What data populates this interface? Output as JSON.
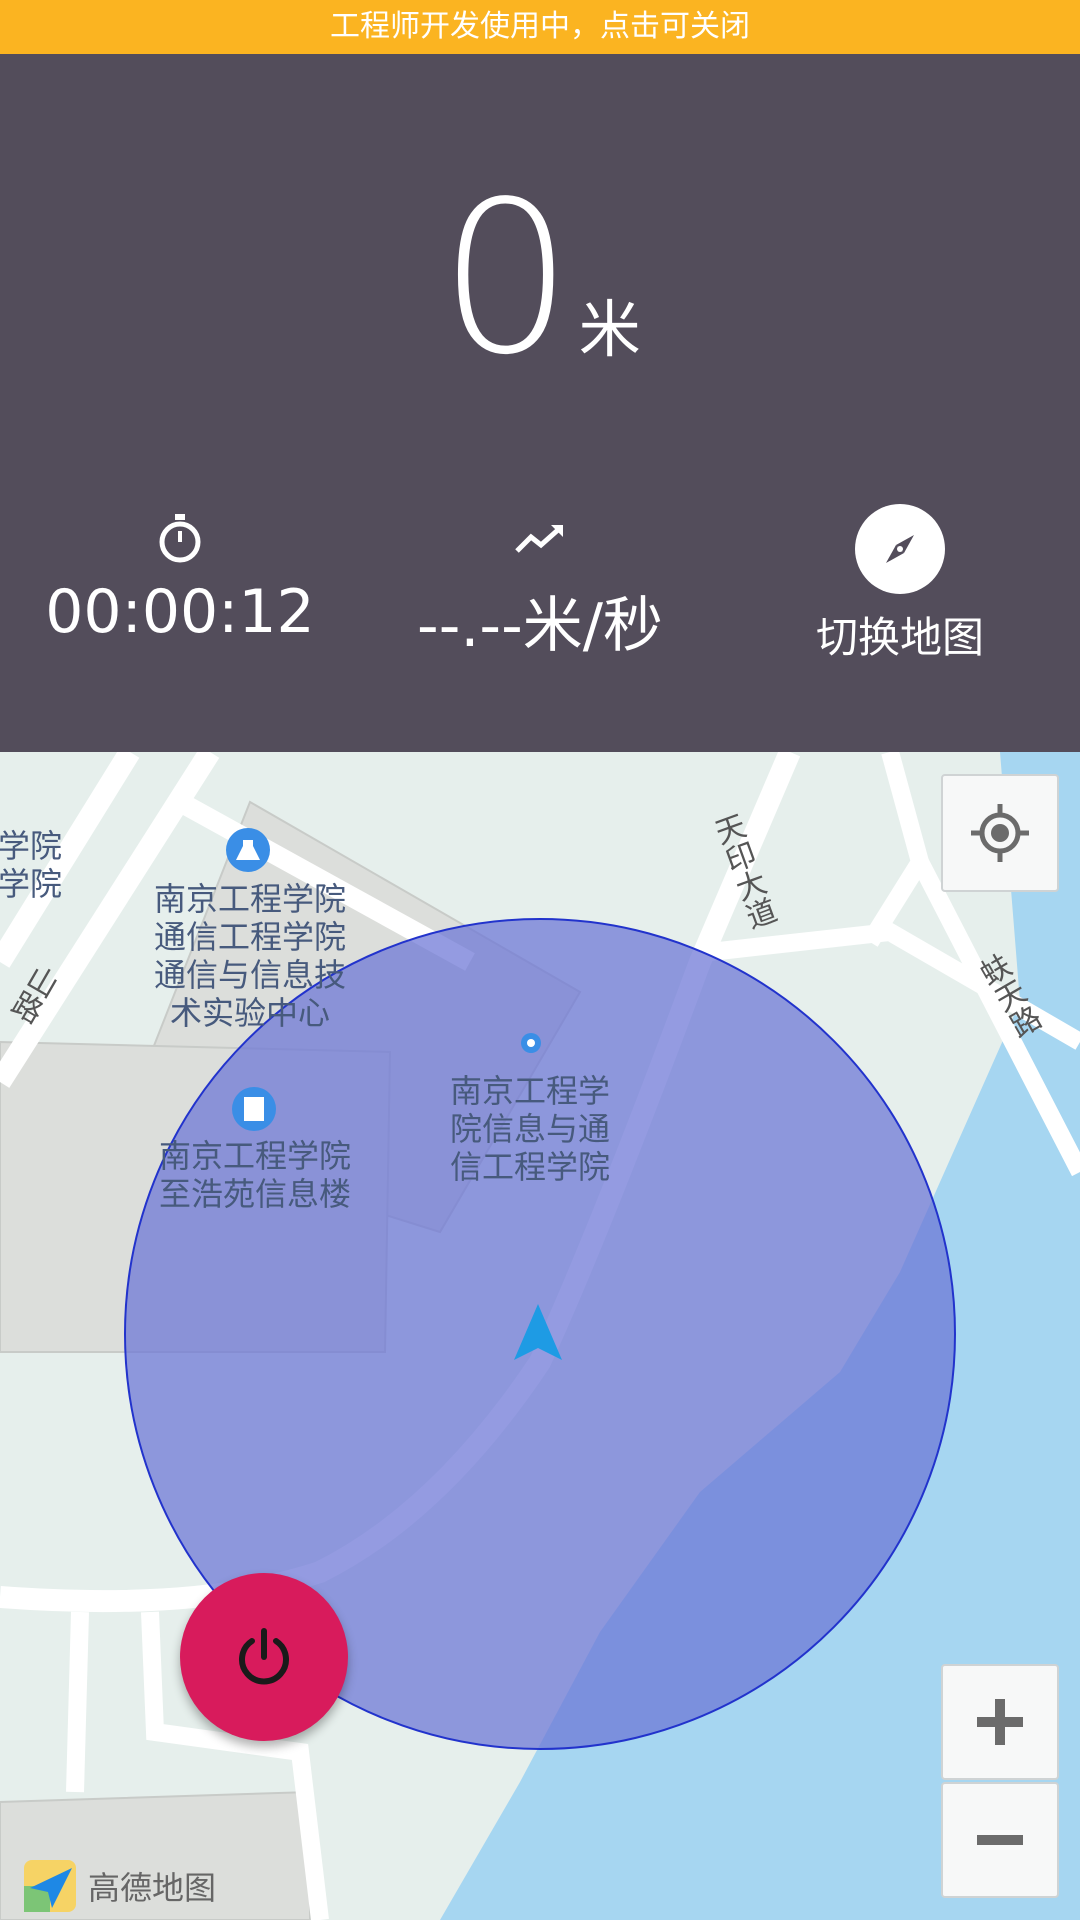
{
  "banner": {
    "text": "工程师开发使用中，点击可关闭"
  },
  "stats": {
    "distance_value": "0",
    "distance_unit": "米",
    "time": "00:00:12",
    "speed": "--.--米/秒",
    "switch_map_label": "切换地图"
  },
  "map": {
    "pois": [
      {
        "label": "南京工程学院通信工程学院通信与信息技术实验中心"
      },
      {
        "label": "南京工程学院信息与通信工程学院"
      },
      {
        "label": "南京工程学院至浩苑信息楼"
      }
    ],
    "poi_lines": [
      [
        "南京工程学院",
        "通信工程学院",
        "通信与信息技",
        "术实验中心"
      ],
      [
        "南京工程学",
        "院信息与通",
        "信工程学院"
      ],
      [
        "南京工程学院",
        "至浩苑信息楼"
      ]
    ],
    "edge_label": [
      "学院",
      "学院"
    ],
    "roads": {
      "tianyin": "天印大道",
      "shanlu": "山路",
      "shan_prefix": "映",
      "right_road": "蚨天路"
    },
    "provider_logo_text": "高德地图"
  },
  "colors": {
    "banner": "#fbb421",
    "stats_bg": "#534d5b",
    "accuracy_circle": "#6b74d6",
    "power_button": "#d81b5c",
    "water": "#a6d6f1"
  }
}
